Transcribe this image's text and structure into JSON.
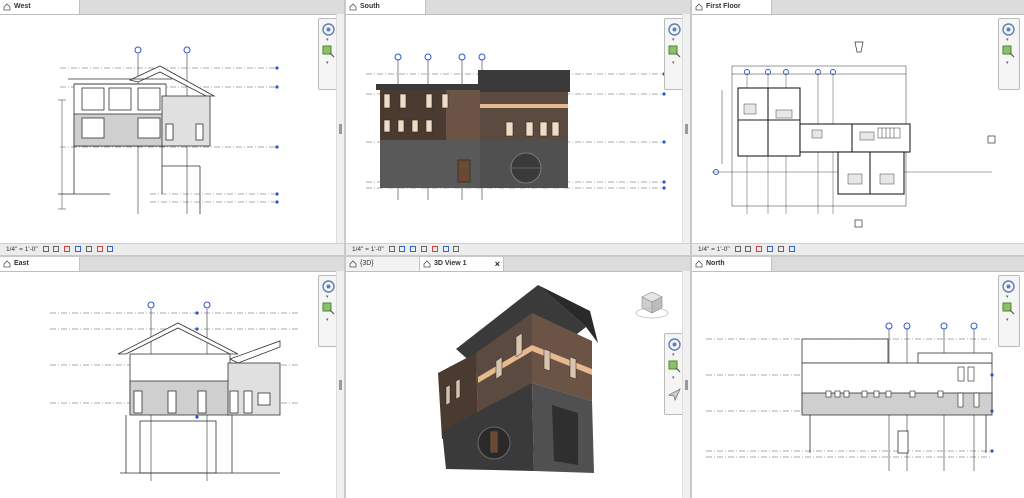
{
  "views": {
    "west": {
      "tab": "West",
      "scale": "1/4\" = 1'-0\""
    },
    "south": {
      "tab": "South",
      "scale": "1/4\" = 1'-0\""
    },
    "first_floor": {
      "tab": "First Floor",
      "scale": "1/4\" = 1'-0\""
    },
    "east": {
      "tab": "East"
    },
    "view3d_inactive": {
      "tab": "{3D}"
    },
    "view3d": {
      "tab": "3D View 1",
      "close": "×"
    },
    "north": {
      "tab": "North"
    }
  },
  "colors": {
    "level_line": "#5a5a5a",
    "grid_bubble": "#2b56c9",
    "shade": "#cfcfcf",
    "roof": "#3a3a3a",
    "wall_dark": "#4a3a30",
    "trim": "#e6b98f"
  },
  "icons": [
    "house-icon",
    "steering-wheel-icon",
    "zoom-icon",
    "close-icon",
    "viewcube-icon"
  ]
}
